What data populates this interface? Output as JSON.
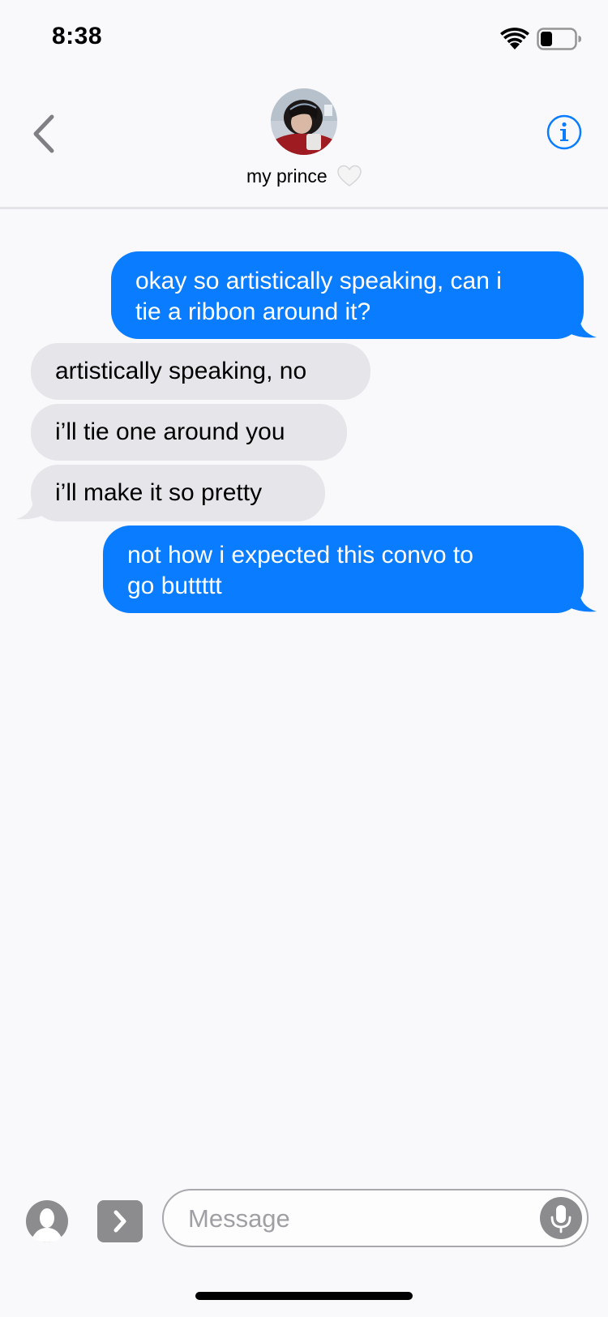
{
  "status_bar": {
    "time": "8:38",
    "wifi_icon": "wifi-icon",
    "battery_icon": "battery-icon",
    "battery_level": 0.35
  },
  "header": {
    "back_icon": "chevron-left-icon",
    "contact_name": "my prince",
    "contact_emoji": "white-heart-icon",
    "info_icon": "info-icon"
  },
  "messages": [
    {
      "direction": "sent",
      "lines": [
        "okay so artistically speaking, can i",
        "tie a ribbon around it?"
      ]
    },
    {
      "direction": "received",
      "lines": [
        "artistically speaking, no"
      ]
    },
    {
      "direction": "received",
      "lines": [
        "i’ll tie one around you"
      ]
    },
    {
      "direction": "received",
      "lines": [
        "i’ll make it so pretty"
      ]
    },
    {
      "direction": "sent",
      "lines": [
        "not how i expected this convo to",
        "go buttttt"
      ]
    }
  ],
  "input_bar": {
    "apps_icon": "app-store-icon",
    "expand_icon": "chevron-right-icon",
    "placeholder": "Message",
    "value": "",
    "mic_icon": "microphone-icon"
  },
  "colors": {
    "sent_bubble": "#0a7cff",
    "received_bubble": "#e6e5ea",
    "accent": "#0a7cff",
    "background": "#f9f9fb"
  }
}
